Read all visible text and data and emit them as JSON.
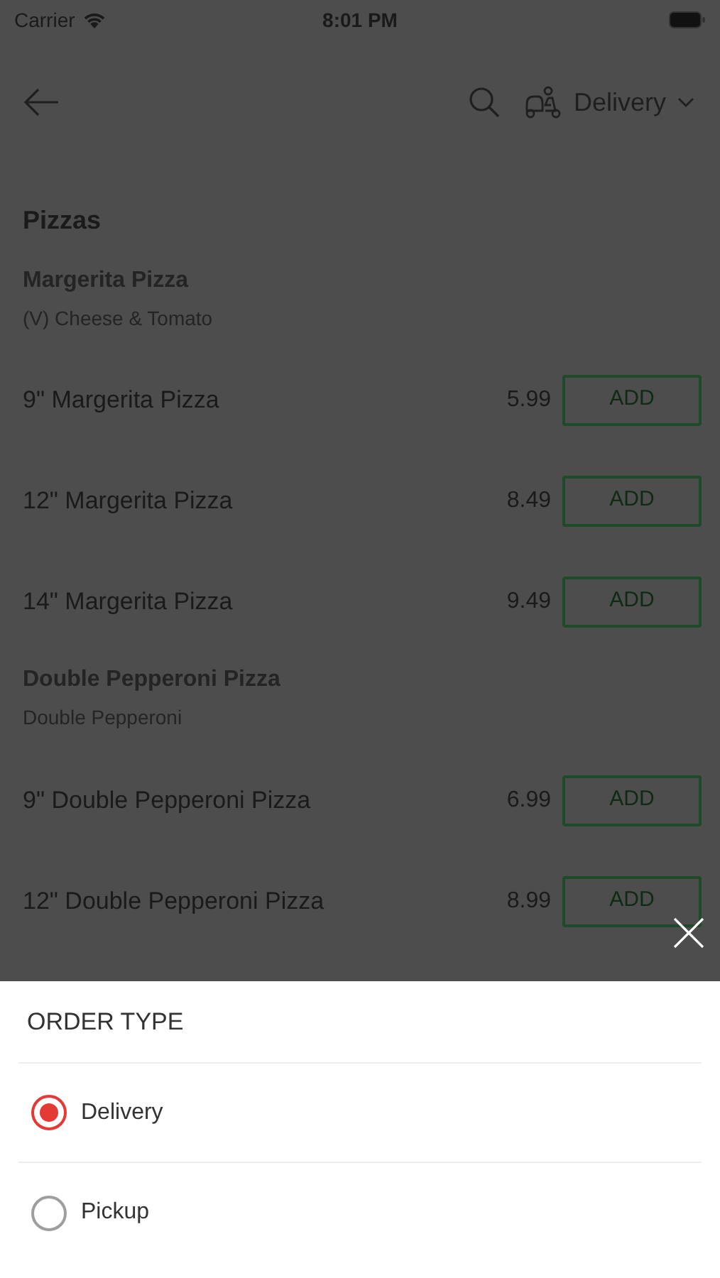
{
  "status_bar": {
    "carrier": "Carrier",
    "time": "8:01 PM"
  },
  "header": {
    "order_type": "Delivery"
  },
  "menu": {
    "title": "Pizzas",
    "sections": [
      {
        "name": "Margerita Pizza",
        "description": "(V) Cheese & Tomato",
        "items": [
          {
            "name": "9\" Margerita  Pizza",
            "price": "5.99",
            "button": "ADD"
          },
          {
            "name": "12\" Margerita  Pizza",
            "price": "8.49",
            "button": "ADD"
          },
          {
            "name": "14\" Margerita  Pizza",
            "price": "9.49",
            "button": "ADD"
          }
        ]
      },
      {
        "name": "Double Pepperoni Pizza",
        "description": "Double Pepperoni",
        "items": [
          {
            "name": "9\" Double Pepperoni Pizza",
            "price": "6.99",
            "button": "ADD"
          },
          {
            "name": "12\" Double Pepperoni Pizza",
            "price": "8.99",
            "button": "ADD"
          }
        ]
      }
    ]
  },
  "sheet": {
    "title": "ORDER TYPE",
    "options": [
      {
        "label": "Delivery",
        "selected": true
      },
      {
        "label": "Pickup",
        "selected": false
      }
    ]
  }
}
